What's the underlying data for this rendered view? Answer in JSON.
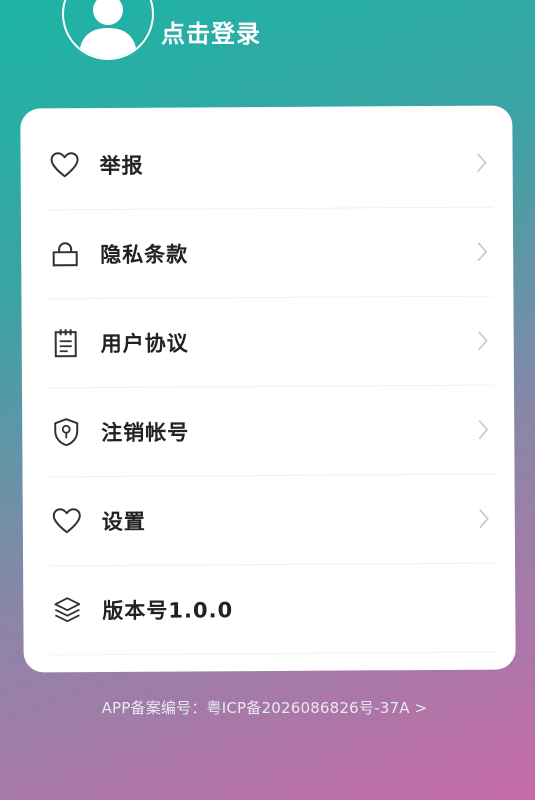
{
  "profile": {
    "avatar_icon": "user-avatar-icon",
    "login_label": "点击登录"
  },
  "menu": [
    {
      "label": "举报",
      "icon": "heart-icon",
      "has_chevron": true
    },
    {
      "label": "隐私条款",
      "icon": "lock-icon",
      "has_chevron": true
    },
    {
      "label": "用户协议",
      "icon": "notepad-icon",
      "has_chevron": true
    },
    {
      "label": "注销帐号",
      "icon": "shield-key-icon",
      "has_chevron": true
    },
    {
      "label": "设置",
      "icon": "heart-icon",
      "has_chevron": true
    },
    {
      "label": "版本号1.0.0",
      "icon": "layers-icon",
      "has_chevron": false
    }
  ],
  "footer": {
    "icp_text": "APP备案编号：粤ICP备2026086826号-37A >"
  },
  "colors": {
    "gradient_start": "#1db5a5",
    "gradient_end": "#c56aa7",
    "card_bg": "#ffffff",
    "label_color": "#222222",
    "chevron_color": "#c8c8c8"
  }
}
